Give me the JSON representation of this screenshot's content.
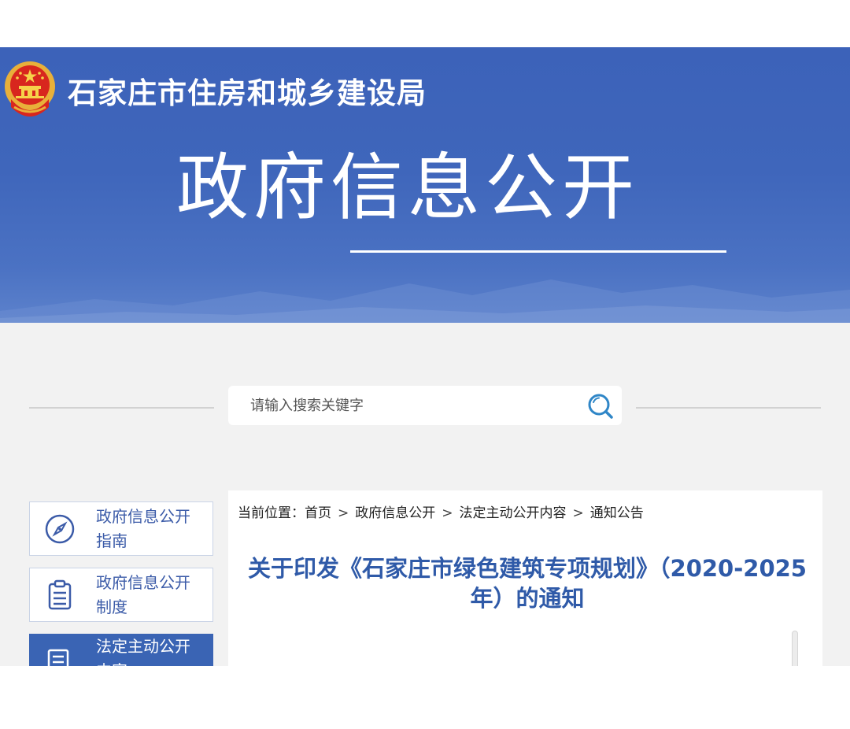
{
  "header": {
    "site_title": "石家庄市住房和城乡建设局",
    "section_title": "政府信息公开"
  },
  "search": {
    "placeholder": "请输入搜索关键字"
  },
  "nav": {
    "items": [
      {
        "label": "政府信息公开指南"
      },
      {
        "label": "政府信息公开制度"
      },
      {
        "label": "法定主动公开内容",
        "active": true
      }
    ]
  },
  "breadcrumb": {
    "prefix": "当前位置：",
    "items": [
      "首页",
      "政府信息公开",
      "法定主动公开内容",
      "通知公告"
    ],
    "separator": ">"
  },
  "article": {
    "title": "关于印发《石家庄市绿色建筑专项规划》（2020-2025年）的通知"
  },
  "colors": {
    "brand_blue": "#3f66bb",
    "link_blue": "#2f5aa8",
    "active_nav": "#3a64b4"
  }
}
